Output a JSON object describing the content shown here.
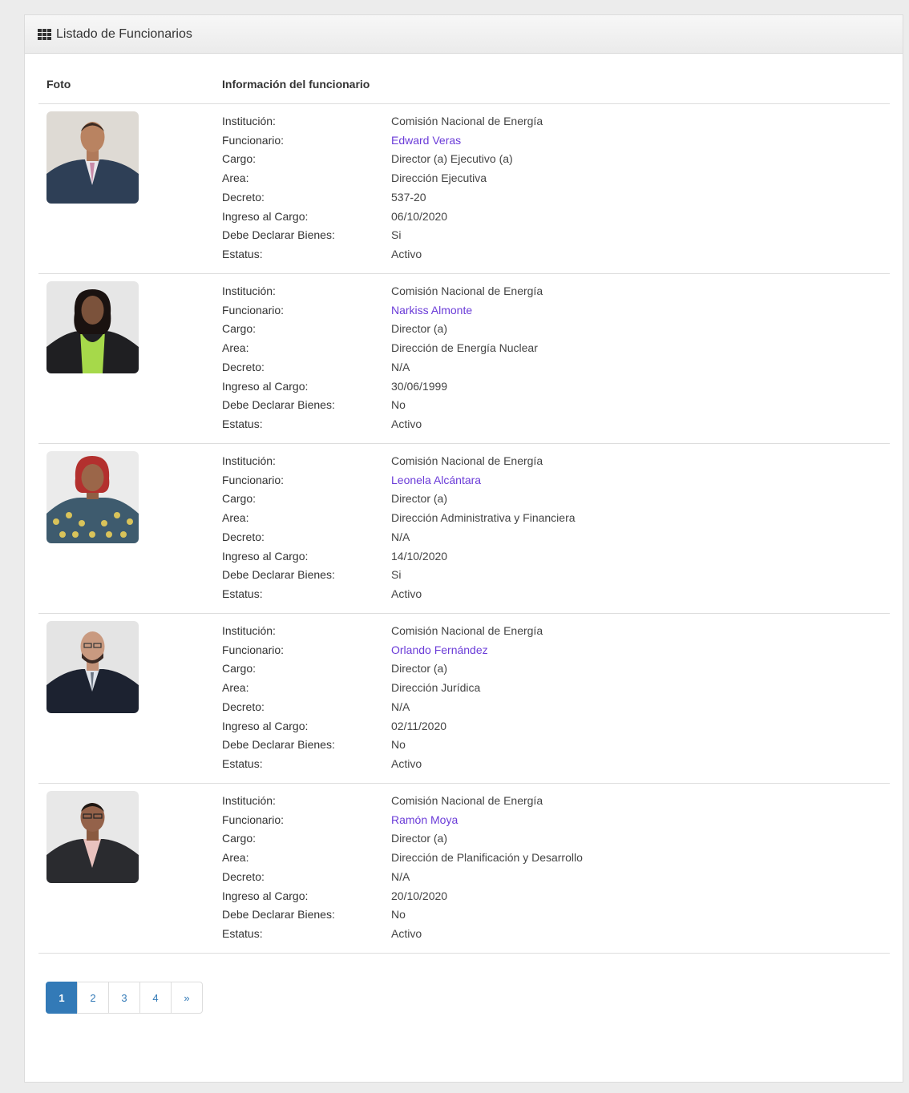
{
  "panel": {
    "title": "Listado de Funcionarios",
    "icon": "grid-icon"
  },
  "table": {
    "col_photo": "Foto",
    "col_info": "Información del funcionario"
  },
  "labels": {
    "institucion": "Institución:",
    "funcionario": "Funcionario:",
    "cargo": "Cargo:",
    "area": "Area:",
    "decreto": "Decreto:",
    "ingreso": "Ingreso al Cargo:",
    "declarar": "Debe Declarar Bienes:",
    "estatus": "Estatus:"
  },
  "officials": [
    {
      "institucion": "Comisión Nacional de Energía",
      "funcionario": "Edward Veras",
      "cargo": "Director (a) Ejecutivo (a)",
      "area": "Dirección Ejecutiva",
      "decreto": "537-20",
      "ingreso": "06/10/2020",
      "declarar": "Si",
      "estatus": "Activo"
    },
    {
      "institucion": "Comisión Nacional de Energía",
      "funcionario": "Narkiss Almonte",
      "cargo": "Director (a)",
      "area": "Dirección de Energía Nuclear",
      "decreto": "N/A",
      "ingreso": "30/06/1999",
      "declarar": "No",
      "estatus": "Activo"
    },
    {
      "institucion": "Comisión Nacional de Energía",
      "funcionario": "Leonela Alcántara",
      "cargo": "Director (a)",
      "area": "Dirección Administrativa y Financiera",
      "decreto": "N/A",
      "ingreso": "14/10/2020",
      "declarar": "Si",
      "estatus": "Activo"
    },
    {
      "institucion": "Comisión Nacional de Energía",
      "funcionario": "Orlando Fernández",
      "cargo": "Director (a)",
      "area": "Dirección Jurídica",
      "decreto": "N/A",
      "ingreso": "02/11/2020",
      "declarar": "No",
      "estatus": "Activo"
    },
    {
      "institucion": "Comisión Nacional de Energía",
      "funcionario": "Ramón Moya",
      "cargo": "Director (a)",
      "area": "Dirección de Planificación y Desarrollo",
      "decreto": "N/A",
      "ingreso": "20/10/2020",
      "declarar": "No",
      "estatus": "Activo"
    }
  ],
  "pagination": {
    "pages": [
      "1",
      "2",
      "3",
      "4"
    ],
    "next": "»",
    "active": "1"
  },
  "colors": {
    "link": "#6b3cd8",
    "accent": "#337ab7"
  }
}
